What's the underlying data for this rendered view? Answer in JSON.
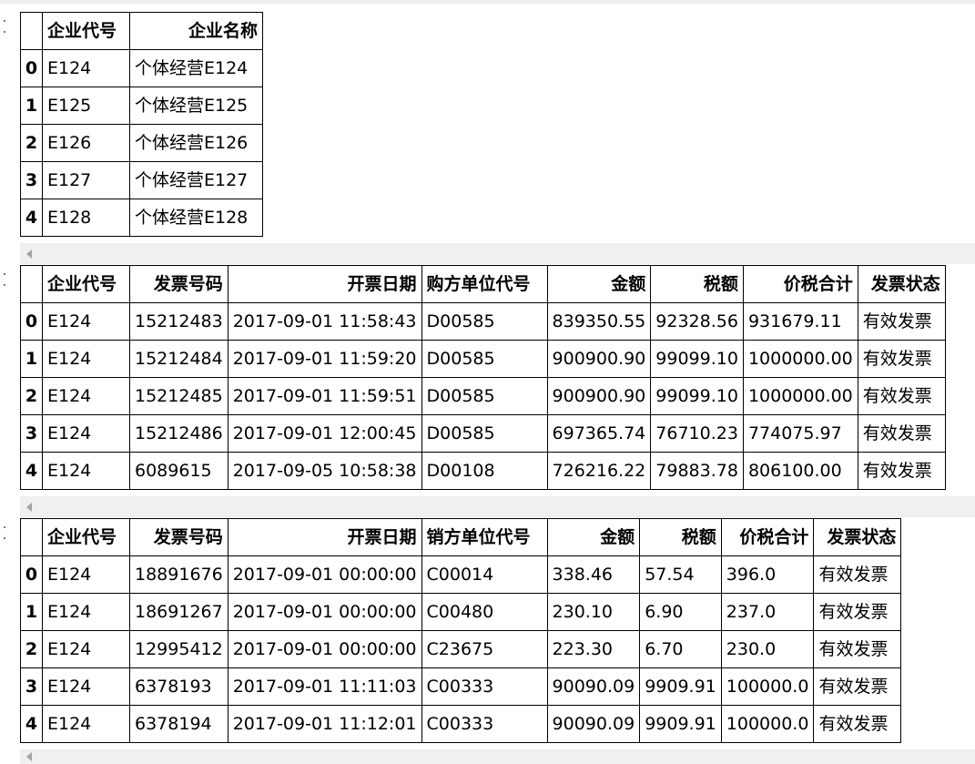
{
  "tables": [
    {
      "columns": [
        "企业代号",
        "企业名称"
      ],
      "index": [
        "0",
        "1",
        "2",
        "3",
        "4"
      ],
      "rows": [
        [
          "E124",
          "个体经营E124"
        ],
        [
          "E125",
          "个体经营E125"
        ],
        [
          "E126",
          "个体经营E126"
        ],
        [
          "E127",
          "个体经营E127"
        ],
        [
          "E128",
          "个体经营E128"
        ]
      ]
    },
    {
      "columns": [
        "企业代号",
        "发票号码",
        "开票日期",
        "购方单位代号",
        "金额",
        "税额",
        "价税合计",
        "发票状态"
      ],
      "index": [
        "0",
        "1",
        "2",
        "3",
        "4"
      ],
      "rows": [
        [
          "E124",
          "15212483",
          "2017-09-01 11:58:43",
          "D00585",
          "839350.55",
          "92328.56",
          "931679.11",
          "有效发票"
        ],
        [
          "E124",
          "15212484",
          "2017-09-01 11:59:20",
          "D00585",
          "900900.90",
          "99099.10",
          "1000000.00",
          "有效发票"
        ],
        [
          "E124",
          "15212485",
          "2017-09-01 11:59:51",
          "D00585",
          "900900.90",
          "99099.10",
          "1000000.00",
          "有效发票"
        ],
        [
          "E124",
          "15212486",
          "2017-09-01 12:00:45",
          "D00585",
          "697365.74",
          "76710.23",
          "774075.97",
          "有效发票"
        ],
        [
          "E124",
          "6089615",
          "2017-09-05 10:58:38",
          "D00108",
          "726216.22",
          "79883.78",
          "806100.00",
          "有效发票"
        ]
      ]
    },
    {
      "columns": [
        "企业代号",
        "发票号码",
        "开票日期",
        "销方单位代号",
        "金额",
        "税额",
        "价税合计",
        "发票状态"
      ],
      "index": [
        "0",
        "1",
        "2",
        "3",
        "4"
      ],
      "rows": [
        [
          "E124",
          "18891676",
          "2017-09-01 00:00:00",
          "C00014",
          "338.46",
          "57.54",
          "396.0",
          "有效发票"
        ],
        [
          "E124",
          "18691267",
          "2017-09-01 00:00:00",
          "C00480",
          "230.10",
          "6.90",
          "237.0",
          "有效发票"
        ],
        [
          "E124",
          "12995412",
          "2017-09-01 00:00:00",
          "C23675",
          "223.30",
          "6.70",
          "230.0",
          "有效发票"
        ],
        [
          "E124",
          "6378193",
          "2017-09-01 11:11:03",
          "C00333",
          "90090.09",
          "9909.91",
          "100000.0",
          "有效发票"
        ],
        [
          "E124",
          "6378194",
          "2017-09-01 11:12:01",
          "C00333",
          "90090.09",
          "9909.91",
          "100000.0",
          "有效发票"
        ]
      ]
    }
  ]
}
